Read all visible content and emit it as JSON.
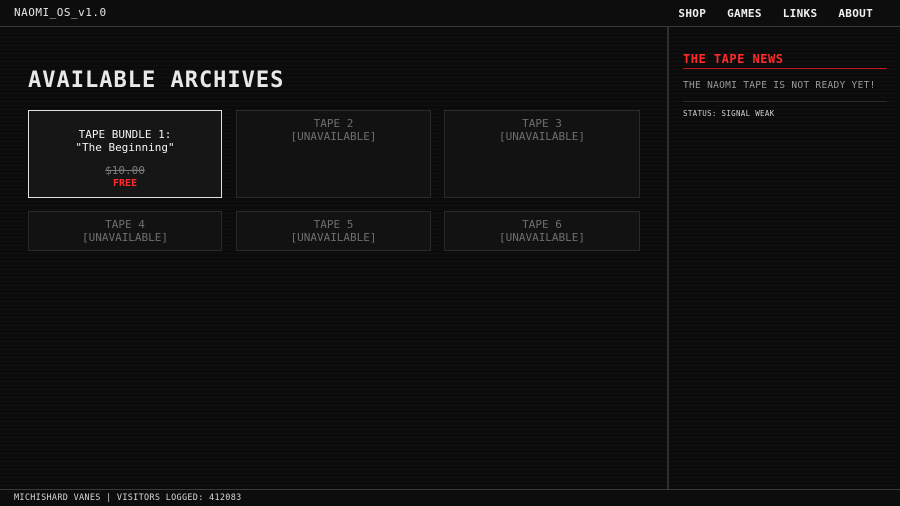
{
  "header": {
    "os_title": "NAOMI_OS_v1.0",
    "nav": [
      "SHOP",
      "GAMES",
      "LINKS",
      "ABOUT"
    ]
  },
  "main": {
    "title": "AVAILABLE ARCHIVES",
    "tapes": [
      {
        "name": "TAPE BUNDLE 1:",
        "subtitle": "\"The Beginning\"",
        "old_price": "$10.00",
        "price": "FREE"
      },
      {
        "name": "TAPE 2",
        "status": "[UNAVAILABLE]"
      },
      {
        "name": "TAPE 3",
        "status": "[UNAVAILABLE]"
      },
      {
        "name": "TAPE 4",
        "status": "[UNAVAILABLE]"
      },
      {
        "name": "TAPE 5",
        "status": "[UNAVAILABLE]"
      },
      {
        "name": "TAPE 6",
        "status": "[UNAVAILABLE]"
      }
    ]
  },
  "sidebar": {
    "title": "THE TAPE NEWS",
    "message": "THE NAOMI TAPE IS NOT READY YET!",
    "status": "STATUS: SIGNAL WEAK"
  },
  "footer": {
    "text": "MICHISHARD VANES | VISITORS LOGGED: 412083"
  },
  "colors": {
    "accent": "#ff2a2a",
    "background": "#0b0b0b"
  }
}
